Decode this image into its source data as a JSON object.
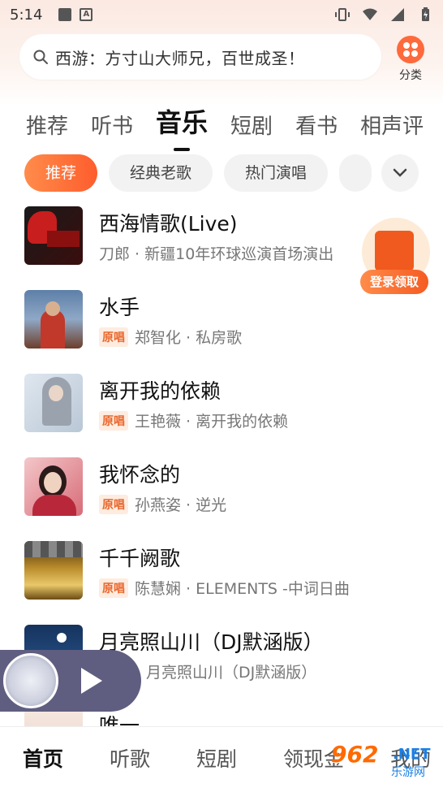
{
  "status_bar": {
    "time": "5:14",
    "a_icon_letter": "A"
  },
  "search": {
    "text": "西游：方寸山大师兄，百世成圣！"
  },
  "category": {
    "label": "分类"
  },
  "tabs": [
    "推荐",
    "听书",
    "音乐",
    "短剧",
    "看书",
    "相声评"
  ],
  "active_tab": 2,
  "chips": [
    "推荐",
    "经典老歌",
    "热门演唱"
  ],
  "songs": [
    {
      "title": "西海情歌(Live)",
      "badge": "",
      "meta": "刀郎 · 新疆10年环球巡演首场演出"
    },
    {
      "title": "水手",
      "badge": "原唱",
      "meta": "郑智化 · 私房歌"
    },
    {
      "title": "离开我的依赖",
      "badge": "原唱",
      "meta": "王艳薇 · 离开我的依赖"
    },
    {
      "title": "我怀念的",
      "badge": "原唱",
      "meta": "孙燕姿 · 逆光"
    },
    {
      "title": "千千阙歌",
      "badge": "原唱",
      "meta": "陈慧娴 · ELEMENTS -中词日曲"
    },
    {
      "title": "月亮照山川（DJ默涵版）",
      "badge": "",
      "meta": "月亮照山川（DJ默涵版）"
    },
    {
      "title": "唯一",
      "badge": "",
      "meta": ""
    }
  ],
  "redpack": {
    "label": "登录领取"
  },
  "bottom_nav": [
    "首页",
    "听歌",
    "短剧",
    "领现金",
    "我的"
  ],
  "watermark": {
    "num": "962",
    "net": ".NET",
    "cn": "乐游网"
  },
  "colors": {
    "accent": "#fe5d2d",
    "badge": "#e9662c"
  }
}
